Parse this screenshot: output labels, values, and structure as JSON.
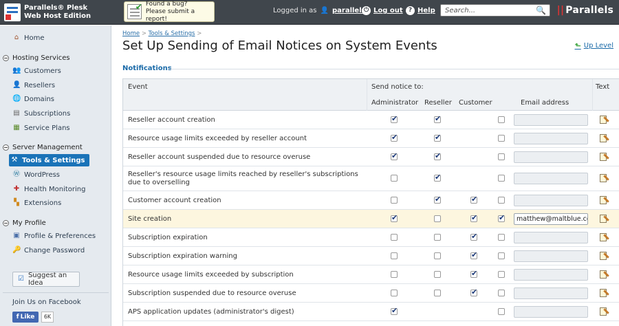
{
  "header": {
    "brand_line1": "Parallels® Plesk",
    "brand_line2": "Web Host Edition",
    "bug_line1": "Found a bug?",
    "bug_line2": "Please submit a report!",
    "logged_in_as": "Logged in as",
    "username": "parallels",
    "logout": "Log out",
    "help": "Help",
    "search_placeholder": "Search...",
    "vendor": "Parallels"
  },
  "sidebar": {
    "home": "Home",
    "hosting_services": "Hosting Services",
    "customers": "Customers",
    "resellers": "Resellers",
    "domains": "Domains",
    "subscriptions": "Subscriptions",
    "service_plans": "Service Plans",
    "server_management": "Server Management",
    "tools_settings": "Tools & Settings",
    "wordpress": "WordPress",
    "health_monitoring": "Health Monitoring",
    "extensions": "Extensions",
    "my_profile": "My Profile",
    "profile_prefs": "Profile & Preferences",
    "change_password": "Change Password",
    "suggest_idea": "Suggest an Idea",
    "facebook_title": "Join Us on Facebook",
    "like": "Like",
    "like_count": "6K"
  },
  "main": {
    "breadcrumb_home": "Home",
    "breadcrumb_tools": "Tools & Settings",
    "breadcrumb_sep": ">",
    "title": "Set Up Sending of Email Notices on System Events",
    "up_level": "Up Level",
    "section": "Notifications",
    "columns": {
      "event": "Event",
      "send_notice": "Send notice to:",
      "administrator": "Administrator",
      "reseller": "Reseller",
      "customer": "Customer",
      "email": "Email address",
      "text": "Text"
    },
    "rows": [
      {
        "event": "Reseller account creation",
        "admin": true,
        "reseller": true,
        "customer": null,
        "other": false,
        "email": ""
      },
      {
        "event": "Resource usage limits exceeded by reseller account",
        "admin": true,
        "reseller": true,
        "customer": null,
        "other": false,
        "email": ""
      },
      {
        "event": "Reseller account suspended due to resource overuse",
        "admin": true,
        "reseller": true,
        "customer": null,
        "other": false,
        "email": ""
      },
      {
        "event": "Reseller's resource usage limits reached by reseller's subscriptions due to overselling",
        "admin": false,
        "reseller": true,
        "customer": null,
        "other": false,
        "email": ""
      },
      {
        "event": "Customer account creation",
        "admin": false,
        "reseller": true,
        "customer": true,
        "other": false,
        "email": ""
      },
      {
        "event": "Site creation",
        "admin": true,
        "reseller": false,
        "customer": true,
        "other": true,
        "email": "matthew@maltblue.co"
      },
      {
        "event": "Subscription expiration",
        "admin": false,
        "reseller": false,
        "customer": true,
        "other": false,
        "email": ""
      },
      {
        "event": "Subscription expiration warning",
        "admin": false,
        "reseller": false,
        "customer": true,
        "other": false,
        "email": ""
      },
      {
        "event": "Resource usage limits exceeded by subscription",
        "admin": false,
        "reseller": false,
        "customer": true,
        "other": false,
        "email": ""
      },
      {
        "event": "Subscription suspended due to resource overuse",
        "admin": false,
        "reseller": false,
        "customer": true,
        "other": false,
        "email": ""
      },
      {
        "event": "APS application updates (administrator's digest)",
        "admin": true,
        "reseller": null,
        "customer": null,
        "other": false,
        "email": ""
      }
    ]
  }
}
